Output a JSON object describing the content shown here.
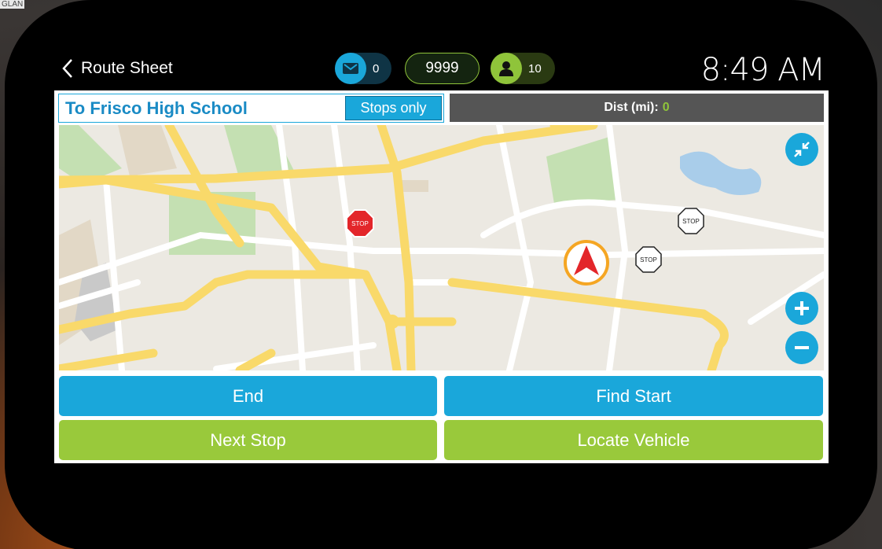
{
  "corner": {
    "text": "GLAN"
  },
  "header": {
    "back_label": "Route Sheet",
    "messages_count": "0",
    "route_number": "9999",
    "riders_count": "10",
    "time": "8:49 AM"
  },
  "route": {
    "title": "To Frisco High School",
    "stops_only_label": "Stops only",
    "dist_label": "Dist (mi):",
    "dist_value": "0"
  },
  "map": {
    "stop_sign_text": "STOP",
    "icons": [
      "collapse-icon",
      "zoom-in-icon",
      "zoom-out-icon",
      "vehicle-arrow-icon"
    ]
  },
  "actions": {
    "end": "End",
    "find_start": "Find Start",
    "next_stop": "Next Stop",
    "locate_vehicle": "Locate Vehicle"
  },
  "colors": {
    "accent_blue": "#1aa7da",
    "accent_green": "#99c93b",
    "road_yellow": "#f9d96a"
  }
}
